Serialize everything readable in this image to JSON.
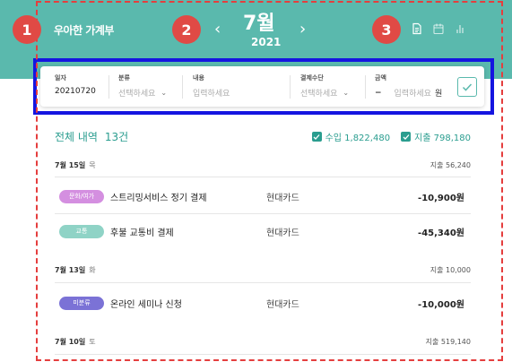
{
  "header": {
    "app_title": "우아한 가계부",
    "month": "7월",
    "year": "2021",
    "prev": "‹",
    "next": "›"
  },
  "annotations": [
    "1",
    "2",
    "3"
  ],
  "view_icons": [
    "document-icon",
    "calendar-icon",
    "chart-icon"
  ],
  "form": {
    "date": {
      "label": "일자",
      "value": "20210720"
    },
    "category": {
      "label": "분류",
      "placeholder": "선택하세요"
    },
    "content": {
      "label": "내용",
      "placeholder": "입력하세요"
    },
    "payment": {
      "label": "결제수단",
      "placeholder": "선택하세요"
    },
    "amount": {
      "label": "금액",
      "sign": "−",
      "placeholder": "입력하세요",
      "unit": "원"
    }
  },
  "list": {
    "title": "전체 내역",
    "count": "13건",
    "income_label": "수입 1,822,480",
    "expense_label": "지출 798,180"
  },
  "days": [
    {
      "date": "7월 15일",
      "dow": "목",
      "total": "지출 56,240",
      "items": [
        {
          "category": "문화/여가",
          "color": "#d48fe0",
          "desc": "스트리밍서비스 정기 결제",
          "method": "현대카드",
          "amount": "-10,900원"
        },
        {
          "category": "교통",
          "color": "#8fd3c6",
          "desc": "후불 교통비 결제",
          "method": "현대카드",
          "amount": "-45,340원"
        }
      ]
    },
    {
      "date": "7월 13일",
      "dow": "화",
      "total": "지출 10,000",
      "items": [
        {
          "category": "미분류",
          "color": "#7b72d6",
          "desc": "온라인 세미나 신청",
          "method": "현대카드",
          "amount": "-10,000원"
        }
      ]
    },
    {
      "date": "7월 10일",
      "dow": "토",
      "total": "지출 519,140",
      "items": []
    }
  ],
  "colors": {
    "header": "#5ab9ad",
    "accent": "#2a9d8f",
    "annotation": "#e04a45",
    "form_outline": "#1515e0"
  }
}
